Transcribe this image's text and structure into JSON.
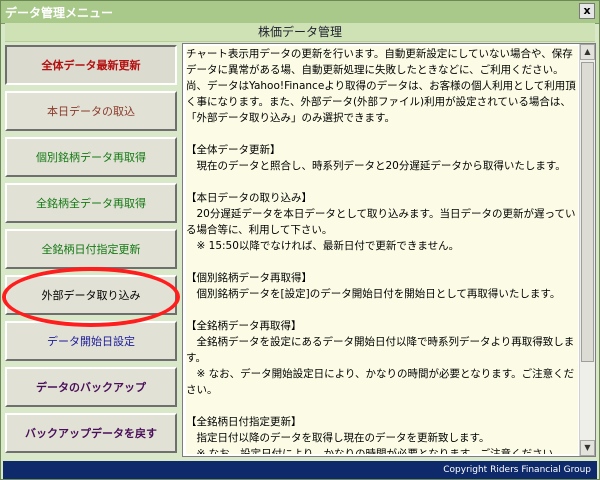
{
  "window": {
    "title": "データ管理メニュー",
    "close_label": "x"
  },
  "header": {
    "title": "株価データ管理"
  },
  "buttons": [
    {
      "label": "全体データ最新更新",
      "color": "#b31010",
      "bold": true
    },
    {
      "label": "本日データの取込",
      "color": "#8a3a2a",
      "bold": false
    },
    {
      "label": "個別銘柄データ再取得",
      "color": "#137a13",
      "bold": false
    },
    {
      "label": "全銘柄全データ再取得",
      "color": "#137a13",
      "bold": false
    },
    {
      "label": "全銘柄日付指定更新",
      "color": "#137a13",
      "bold": false
    },
    {
      "label": "外部データ取り込み",
      "color": "#000000",
      "bold": false
    },
    {
      "label": "データ開始日設定",
      "color": "#1c1c9a",
      "bold": false
    },
    {
      "label": "データのバックアップ",
      "color": "#4a0f5a",
      "bold": true
    },
    {
      "label": "バックアップデータを戻す",
      "color": "#4a0f5a",
      "bold": true
    }
  ],
  "content": {
    "text": "チャート表示用データの更新を行います。自動更新設定にしていない場合や、保存データに異常がある場、自動更新処理に失敗したときなどに、ご利用ください。尚、データはYahoo!Financeより取得のデータは、お客様の個人利用として利用頂く事になります。また、外部データ(外部ファイル)利用が設定されている場合は、「外部データ取り込み」のみ選択できます。\n\n【全体データ更新】\n　現在のデータと照合し、時系列データと20分遅延データから取得いたします。\n\n【本日データの取り込み】\n　20分遅延データを本日データとして取り込みます。当日データの更新が遅っている場合等に、利用して下さい。\n　※ 15:50以降でなければ、最新日付で更新できません。\n\n【個別銘柄データ再取得】\n　個別銘柄データを[設定]のデータ開始日付を開始日として再取得いたします。\n\n【全銘柄データ再取得】\n　全銘柄データを設定にあるデータ開始日付以降で時系列データより再取得致します。\n　※ なお、データ開始設定日により、かなりの時間が必要となります。ご注意ください。\n\n【全銘柄日付指定更新】\n　指定日付以降のデータを取得し現在のデータを更新致します。\n　※ なお、設定日付により、かなりの時間が必要となります。ご注意ください。"
  },
  "footer": {
    "text": "Copyright Riders Financial Group"
  },
  "colors": {
    "annotation": "#ff1d1d",
    "footer_bg": "#0f2a6a"
  }
}
